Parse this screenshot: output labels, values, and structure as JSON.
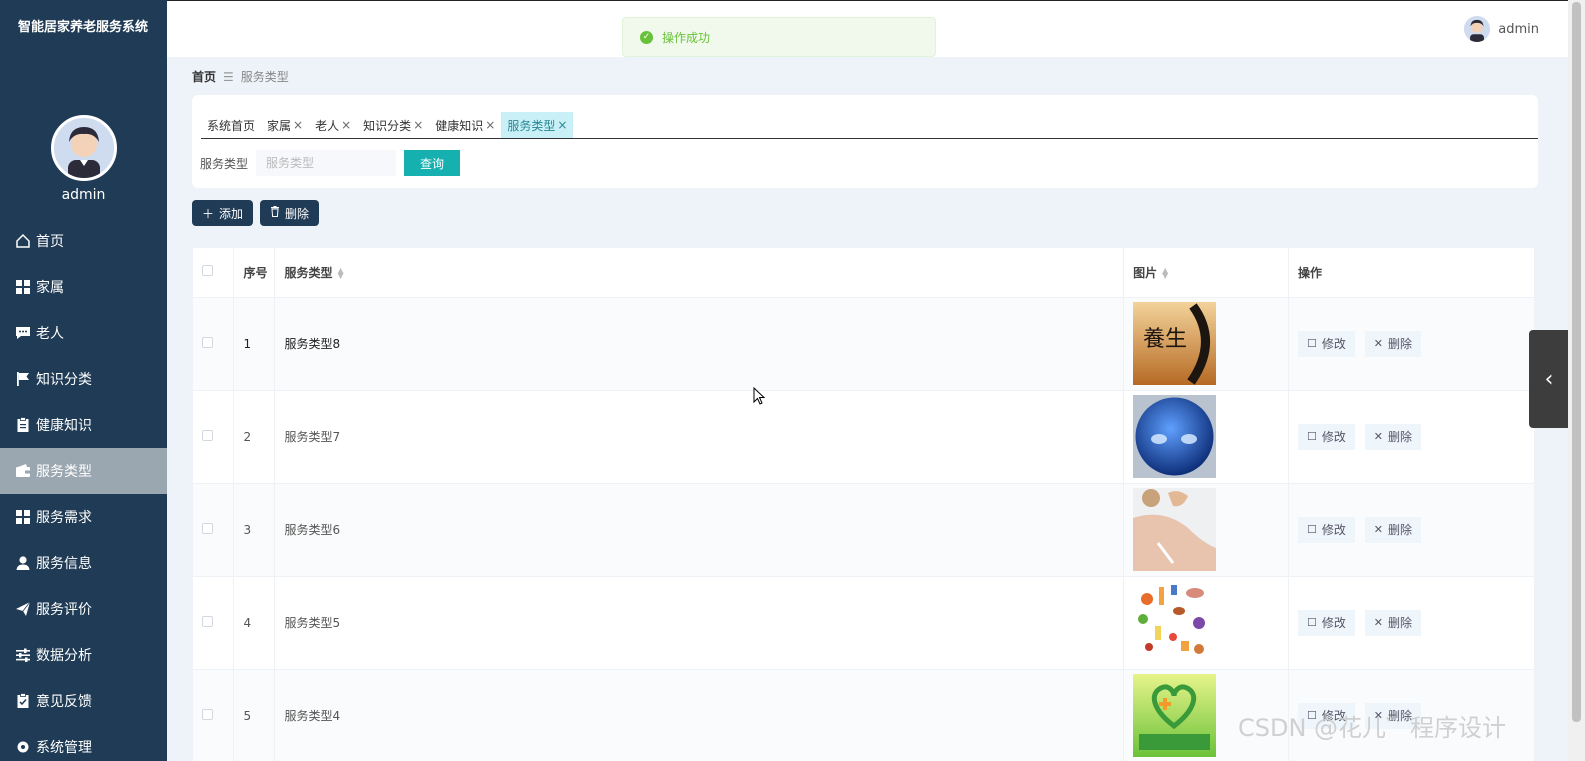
{
  "app": {
    "title": "智能居家养老服务系统",
    "user": "admin"
  },
  "toast": {
    "message": "操作成功"
  },
  "breadcrumb": {
    "home": "首页",
    "current": "服务类型"
  },
  "tabs": [
    {
      "label": "系统首页"
    },
    {
      "label": "家属"
    },
    {
      "label": "老人"
    },
    {
      "label": "知识分类"
    },
    {
      "label": "健康知识"
    },
    {
      "label": "服务类型"
    }
  ],
  "menu": [
    {
      "label": "首页",
      "icon": "home-icon"
    },
    {
      "label": "家属",
      "icon": "grid-icon"
    },
    {
      "label": "老人",
      "icon": "chat-icon"
    },
    {
      "label": "知识分类",
      "icon": "flag-icon"
    },
    {
      "label": "健康知识",
      "icon": "clipboard-icon"
    },
    {
      "label": "服务类型",
      "icon": "wallet-icon"
    },
    {
      "label": "服务需求",
      "icon": "grid-icon"
    },
    {
      "label": "服务信息",
      "icon": "user-icon"
    },
    {
      "label": "服务评价",
      "icon": "send-icon"
    },
    {
      "label": "数据分析",
      "icon": "sliders-icon"
    },
    {
      "label": "意见反馈",
      "icon": "clipboard-check-icon"
    },
    {
      "label": "系统管理",
      "icon": "gear-icon"
    }
  ],
  "search": {
    "label": "服务类型",
    "placeholder": "服务类型",
    "value": "",
    "button": "查询"
  },
  "toolbar": {
    "add": "添加",
    "delete": "删除"
  },
  "table": {
    "headers": {
      "index": "序号",
      "type": "服务类型",
      "image": "图片",
      "ops": "操作"
    },
    "rows": [
      {
        "index": "1",
        "name": "服务类型8",
        "image": "yangsheng-calligraphy"
      },
      {
        "index": "2",
        "name": "服务类型7",
        "image": "blue-ball"
      },
      {
        "index": "3",
        "name": "服务类型6",
        "image": "shoulder-massage"
      },
      {
        "index": "4",
        "name": "服务类型5",
        "image": "food-illustration"
      },
      {
        "index": "5",
        "name": "服务类型4",
        "image": "health-assistant-logo"
      }
    ],
    "edit_label": "修改",
    "delete_label": "删除"
  },
  "watermark": "CSDN @花儿゛程序设计"
}
